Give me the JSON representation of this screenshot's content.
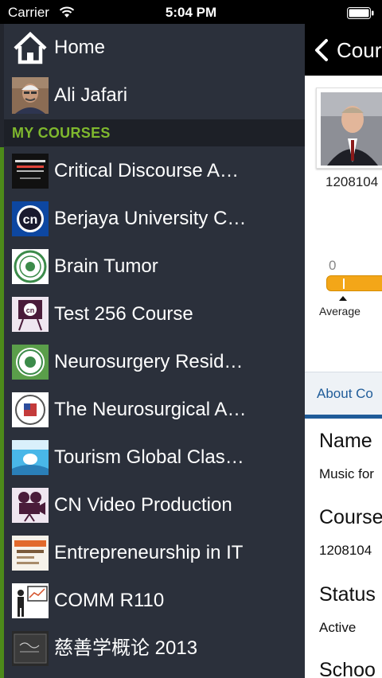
{
  "status_bar": {
    "carrier": "Carrier",
    "time": "5:04 PM"
  },
  "sidebar": {
    "home_label": "Home",
    "user_name": "Ali Jafari",
    "section_title": "MY COURSES",
    "courses": [
      {
        "label": "Critical Discourse A…",
        "thumb": "research-methods-thumbnail"
      },
      {
        "label": "Berjaya University C…",
        "thumb": "cn-logo-thumbnail"
      },
      {
        "label": "Brain Tumor",
        "thumb": "seal-thumbnail"
      },
      {
        "label": "Test 256 Course",
        "thumb": "cn-easel-thumbnail"
      },
      {
        "label": "Neurosurgery Resid…",
        "thumb": "seal-green-thumbnail"
      },
      {
        "label": "The Neurosurgical A…",
        "thumb": "society-seal-thumbnail"
      },
      {
        "label": "Tourism Global Clas…",
        "thumb": "tourism-thumbnail"
      },
      {
        "label": "CN Video Production",
        "thumb": "projector-thumbnail"
      },
      {
        "label": "Entrepreneurship in IT",
        "thumb": "entrepreneurship-thumbnail"
      },
      {
        "label": "COMM R110",
        "thumb": "presenter-thumbnail"
      },
      {
        "label": "慈善学概论 2013",
        "thumb": "chalkboard-thumbnail"
      }
    ]
  },
  "main": {
    "nav_title": "Cour",
    "instructor_id": "1208104",
    "score_value": "0",
    "score_fraction": 0.0,
    "average_label": "Average",
    "about_tab_label": "About Co",
    "fields": [
      {
        "label": "Name",
        "value": "Music for"
      },
      {
        "label": "Course",
        "value": "1208104"
      },
      {
        "label": "Status",
        "value": "Active"
      },
      {
        "label": "Schoo",
        "value": ""
      }
    ]
  },
  "colors": {
    "sidebar_bg": "#2b303b",
    "section_header_text": "#7fb82e",
    "accent_green": "#4d8a1a",
    "progress_orange": "#f3a618",
    "link_blue": "#1f5c99"
  }
}
